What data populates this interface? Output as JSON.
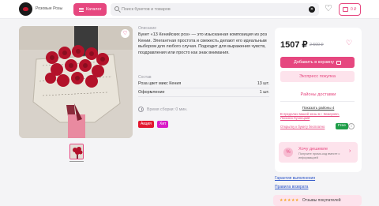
{
  "header": {
    "brand": "Розовые Розы",
    "catalog_label": "Каталог",
    "search_placeholder": "Поиск букетов и товаров",
    "cart_total": "0 ₽"
  },
  "product": {
    "description_title": "Описание",
    "description": "Букет «13 Кенийских роз» — это изысканная композиция из роз Кении. Элегантная простота и свежесть делают его идеальным выбором для любого случая. Подходит для выражения чувств, поздравления или просто как знак внимания.",
    "composition_title": "Состав",
    "composition": [
      {
        "name": "Роза цвет микс Кения",
        "qty": "13 шт."
      },
      {
        "name": "Оформление",
        "qty": "1 шт."
      }
    ],
    "assembly_time": "Время сборки: 0 мин.",
    "tags": [
      "Акция",
      "Хит"
    ]
  },
  "purchase": {
    "price": "1507 ₽",
    "old_price": "2 500 ₽",
    "add_to_cart": "Добавить в корзину",
    "express": "Экспресс покупка",
    "delivery_title": "Районы доставки",
    "show_areas": "Показать районы 4",
    "zone_text": "В пределах вашей зоны в г. Кемерово, Ленинск-Кузнецкий",
    "postcard": "Открытку к букету бесплатно",
    "free_badge": "Free",
    "promo_title": "Хочу дешевле",
    "promo_text": "Получите промо-код вместе с информацией"
  },
  "links": {
    "guarantee": "Гарантия выполнения",
    "returns": "Правила возврата"
  },
  "reviews": {
    "stars": "★★★★★",
    "label": "Отзывы покупателей"
  },
  "colors": {
    "accent": "#e6477f",
    "sale": "#e2172f",
    "hit": "#d81bc7",
    "free": "#1f9e49"
  }
}
